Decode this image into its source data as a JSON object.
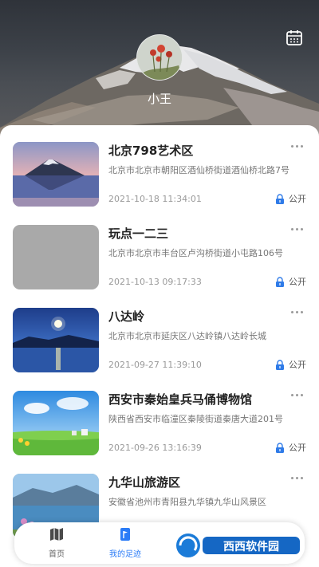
{
  "profile": {
    "username": "小王"
  },
  "icons": {
    "calendar": "calendar-icon",
    "more": "more-dots-icon",
    "lock": "lock-icon",
    "home": "map-icon",
    "footprint": "flag-icon"
  },
  "colors": {
    "accent": "#2b7cf7",
    "lock": "#2f7be8",
    "text_main": "#222222",
    "text_sub": "#777777"
  },
  "cards": [
    {
      "title": "北京798艺术区",
      "address": "北京市北京市朝阳区酒仙桥街道酒仙桥北路7号",
      "time": "2021-10-18 11:34:01",
      "privacy": "公开"
    },
    {
      "title": "玩点一二三",
      "address": "北京市北京市丰台区卢沟桥街道小屯路106号",
      "time": "2021-10-13 09:17:33",
      "privacy": "公开"
    },
    {
      "title": "八达岭",
      "address": "北京市北京市延庆区八达岭镇八达岭长城",
      "time": "2021-09-27 11:39:10",
      "privacy": "公开"
    },
    {
      "title": "西安市秦始皇兵马俑博物馆",
      "address": "陕西省西安市临潼区秦陵街道秦唐大道201号",
      "time": "2021-09-26 13:16:39",
      "privacy": "公开"
    },
    {
      "title": "九华山旅游区",
      "address": "安徽省池州市青阳县九华镇九华山风景区",
      "time": "",
      "privacy": ""
    }
  ],
  "nav": {
    "home_label": "首页",
    "footprint_label": "我的足迹",
    "active": "footprint"
  },
  "watermark": {
    "brand": "西西软件园",
    "url": "CR173.COM"
  }
}
